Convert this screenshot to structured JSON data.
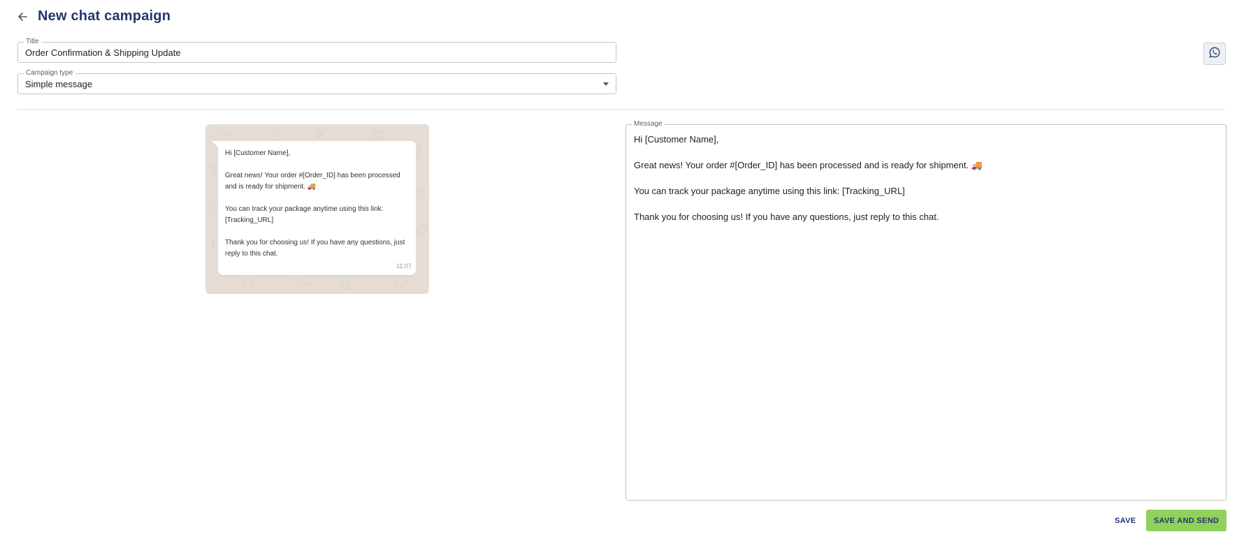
{
  "header": {
    "title": "New chat campaign",
    "back_icon": "arrow-left-icon"
  },
  "form": {
    "title_label": "Title",
    "title_value": "Order Confirmation & Shipping Update",
    "campaign_type_label": "Campaign type",
    "campaign_type_value": "Simple message"
  },
  "channel_icon": "whatsapp-icon",
  "preview": {
    "message": "Hi [Customer Name],\n\nGreat news! Your order #[Order_ID] has been processed and is ready for shipment. 🚚\n\nYou can track your package anytime using this link: [Tracking_URL]\n\nThank you for choosing us! If you have any questions, just reply to this chat.",
    "time": "11:07"
  },
  "message": {
    "label": "Message",
    "value": "Hi [Customer Name],\n\nGreat news! Your order #[Order_ID] has been processed and is ready for shipment. 🚚\n\nYou can track your package anytime using this link: [Tracking_URL]\n\nThank you for choosing us! If you have any questions, just reply to this chat."
  },
  "actions": {
    "save": "SAVE",
    "save_and_send": "SAVE AND SEND"
  },
  "colors": {
    "primary": "#253570",
    "accent_green": "#8fd15a",
    "chat_bg": "#e5ddd5"
  }
}
